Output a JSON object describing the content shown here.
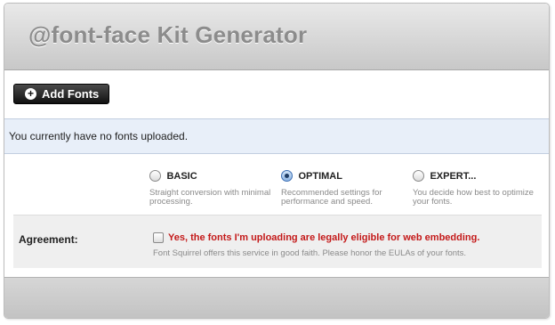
{
  "header": {
    "title": "@font-face Kit Generator"
  },
  "toolbar": {
    "add_fonts_label": "Add Fonts",
    "add_icon": "+"
  },
  "notice": {
    "text": "You currently have no fonts uploaded."
  },
  "options": [
    {
      "label": "BASIC",
      "description": "Straight conversion with minimal processing.",
      "selected": false
    },
    {
      "label": "OPTIMAL",
      "description": "Recommended settings for performance and speed.",
      "selected": true
    },
    {
      "label": "EXPERT...",
      "description": "You decide how best to optimize your fonts.",
      "selected": false
    }
  ],
  "agreement": {
    "label": "Agreement:",
    "checkbox_text": "Yes, the fonts I'm uploading are legally eligible for web embedding.",
    "note": "Font Squirrel offers this service in good faith. Please honor the EULAs of your fonts.",
    "checked": false
  },
  "colors": {
    "warning_text": "#c41a1a",
    "notice_bg": "#e8eff9"
  }
}
